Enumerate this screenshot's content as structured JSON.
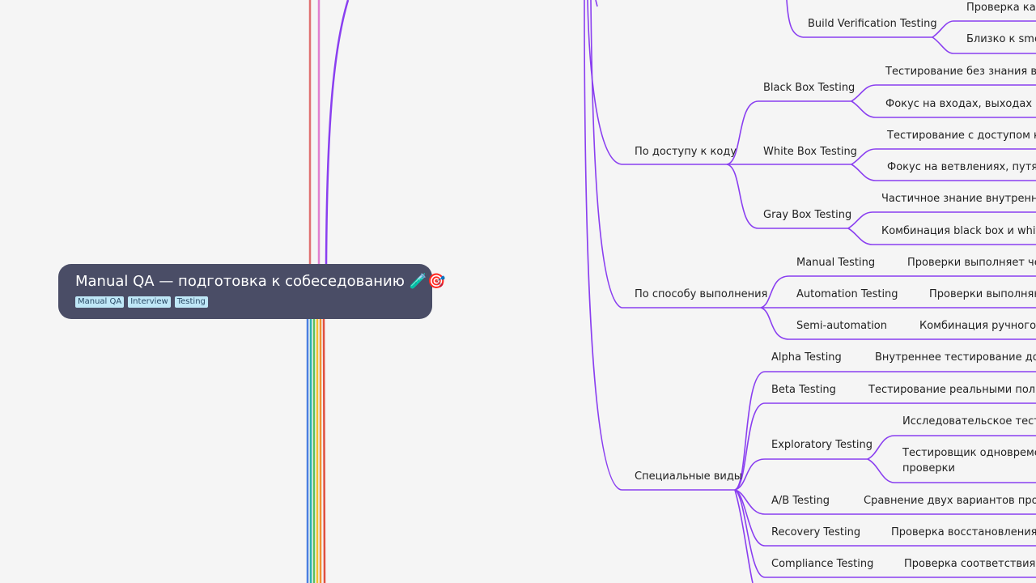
{
  "root": {
    "title": "Manual QA — подготовка к собеседованию 🧪🎯",
    "tags": [
      "Manual QA",
      "Interview",
      "Testing"
    ]
  },
  "branch_color": "#8a3ff0",
  "nodes": {
    "build_verification": "Build Verification Testing",
    "bvt_1": "Проверка кач",
    "bvt_2": "Близко к smok",
    "by_code_access": "По доступу к коду",
    "black_box": "Black Box Testing",
    "bb_1": "Тестирование без знания вну",
    "bb_2": "Фокус на входах, выходах и по",
    "white_box": "White Box Testing",
    "wb_1": "Тестирование с доступом к ко",
    "wb_2": "Фокус на ветвлениях, путях, п",
    "gray_box": "Gray Box Testing",
    "gb_1": "Частичное знание внутреннег",
    "gb_2": "Комбинация black box и white",
    "by_execution": "По способу выполнения",
    "manual": "Manual Testing",
    "manual_1": "Проверки выполняет чел",
    "automation": "Automation Testing",
    "automation_1": "Проверки выполняю",
    "semi": "Semi-automation",
    "semi_1": "Комбинация ручного и",
    "special": "Специальные виды",
    "alpha": "Alpha Testing",
    "alpha_1": "Внутреннее тестирование до пе",
    "beta": "Beta Testing",
    "beta_1": "Тестирование реальными пользо",
    "exploratory": "Exploratory Testing",
    "expl_1": "Исследовательское тестир",
    "expl_2a": "Тестировщик одновремен",
    "expl_2b": "проверки",
    "ab": "A/B Testing",
    "ab_1": "Сравнение двух вариантов проду",
    "recovery": "Recovery Testing",
    "recovery_1": "Проверка восстановления п",
    "compliance": "Compliance Testing",
    "compliance_1": "Проверка соответствия ст"
  }
}
